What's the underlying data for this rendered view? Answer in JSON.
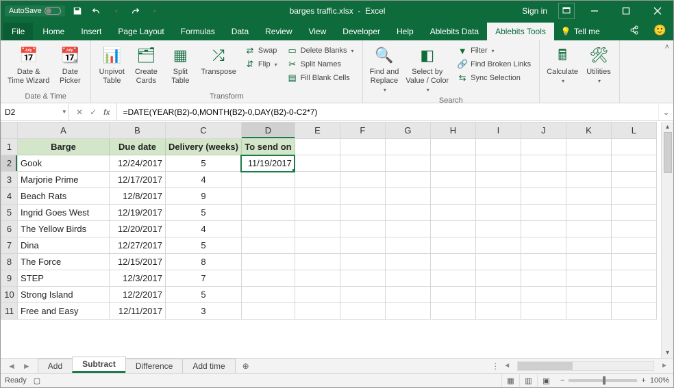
{
  "titlebar": {
    "autosave": "AutoSave",
    "title_file": "barges traffic.xlsx",
    "title_sep": "-",
    "title_app": "Excel",
    "signin": "Sign in"
  },
  "tabs": {
    "file": "File",
    "home": "Home",
    "insert": "Insert",
    "page_layout": "Page Layout",
    "formulas": "Formulas",
    "data": "Data",
    "review": "Review",
    "view": "View",
    "developer": "Developer",
    "help": "Help",
    "ablebits_data": "Ablebits Data",
    "ablebits_tools": "Ablebits Tools",
    "tellme": "Tell me"
  },
  "ribbon": {
    "groups": {
      "datetime": "Date & Time",
      "transform": "Transform",
      "search": "Search"
    },
    "btns": {
      "date_time_wizard": "Date &\nTime Wizard",
      "date_picker": "Date\nPicker",
      "unpivot_table": "Unpivot\nTable",
      "create_cards": "Create\nCards",
      "split_table": "Split\nTable",
      "transpose": "Transpose",
      "swap": "Swap",
      "flip": "Flip",
      "delete_blanks": "Delete Blanks",
      "split_names": "Split Names",
      "fill_blank_cells": "Fill Blank Cells",
      "find_replace": "Find and\nReplace",
      "select_by_value": "Select by\nValue / Color",
      "filter": "Filter",
      "find_broken_links": "Find Broken Links",
      "sync_selection": "Sync Selection",
      "calculate": "Calculate",
      "utilities": "Utilities"
    }
  },
  "formula": {
    "namebox": "D2",
    "fx": "fx",
    "text": "=DATE(YEAR(B2)-0,MONTH(B2)-0,DAY(B2)-0-C2*7)"
  },
  "columns": [
    "A",
    "B",
    "C",
    "D",
    "E",
    "F",
    "G",
    "H",
    "I",
    "J",
    "K",
    "L"
  ],
  "headers": {
    "A": "Barge",
    "B": "Due date",
    "C": "Delivery (weeks)",
    "D": "To send on"
  },
  "rows": [
    {
      "n": 2,
      "A": "Gook",
      "B": "12/24/2017",
      "C": "5",
      "D": "11/19/2017"
    },
    {
      "n": 3,
      "A": "Marjorie Prime",
      "B": "12/17/2017",
      "C": "4",
      "D": ""
    },
    {
      "n": 4,
      "A": "Beach Rats",
      "B": "12/8/2017",
      "C": "9",
      "D": ""
    },
    {
      "n": 5,
      "A": "Ingrid Goes West",
      "B": "12/19/2017",
      "C": "5",
      "D": ""
    },
    {
      "n": 6,
      "A": "The Yellow Birds",
      "B": "12/20/2017",
      "C": "4",
      "D": ""
    },
    {
      "n": 7,
      "A": "Dina",
      "B": "12/27/2017",
      "C": "5",
      "D": ""
    },
    {
      "n": 8,
      "A": "The Force",
      "B": "12/15/2017",
      "C": "8",
      "D": ""
    },
    {
      "n": 9,
      "A": "STEP",
      "B": "12/3/2017",
      "C": "7",
      "D": ""
    },
    {
      "n": 10,
      "A": "Strong Island",
      "B": "12/2/2017",
      "C": "5",
      "D": ""
    },
    {
      "n": 11,
      "A": "Free and Easy",
      "B": "12/11/2017",
      "C": "3",
      "D": ""
    }
  ],
  "sheets": {
    "add": "Add",
    "subtract": "Subtract",
    "difference": "Difference",
    "addtime": "Add time"
  },
  "status": {
    "ready": "Ready",
    "zoom": "100%"
  }
}
